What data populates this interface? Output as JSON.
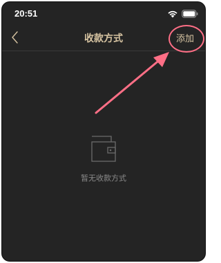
{
  "status_bar": {
    "time": "20:51",
    "icons": [
      "wifi-icon",
      "battery-icon"
    ]
  },
  "nav": {
    "back_icon": "chevron-left-icon",
    "title": "收款方式",
    "add_label": "添加"
  },
  "empty_state": {
    "icon": "wallet-icon",
    "text": "暂无收款方式"
  },
  "annotation": {
    "color": "#ff6f86"
  },
  "colors": {
    "background": "#242424",
    "accent": "#d7c4a2",
    "muted_text": "#8a8a8a"
  }
}
